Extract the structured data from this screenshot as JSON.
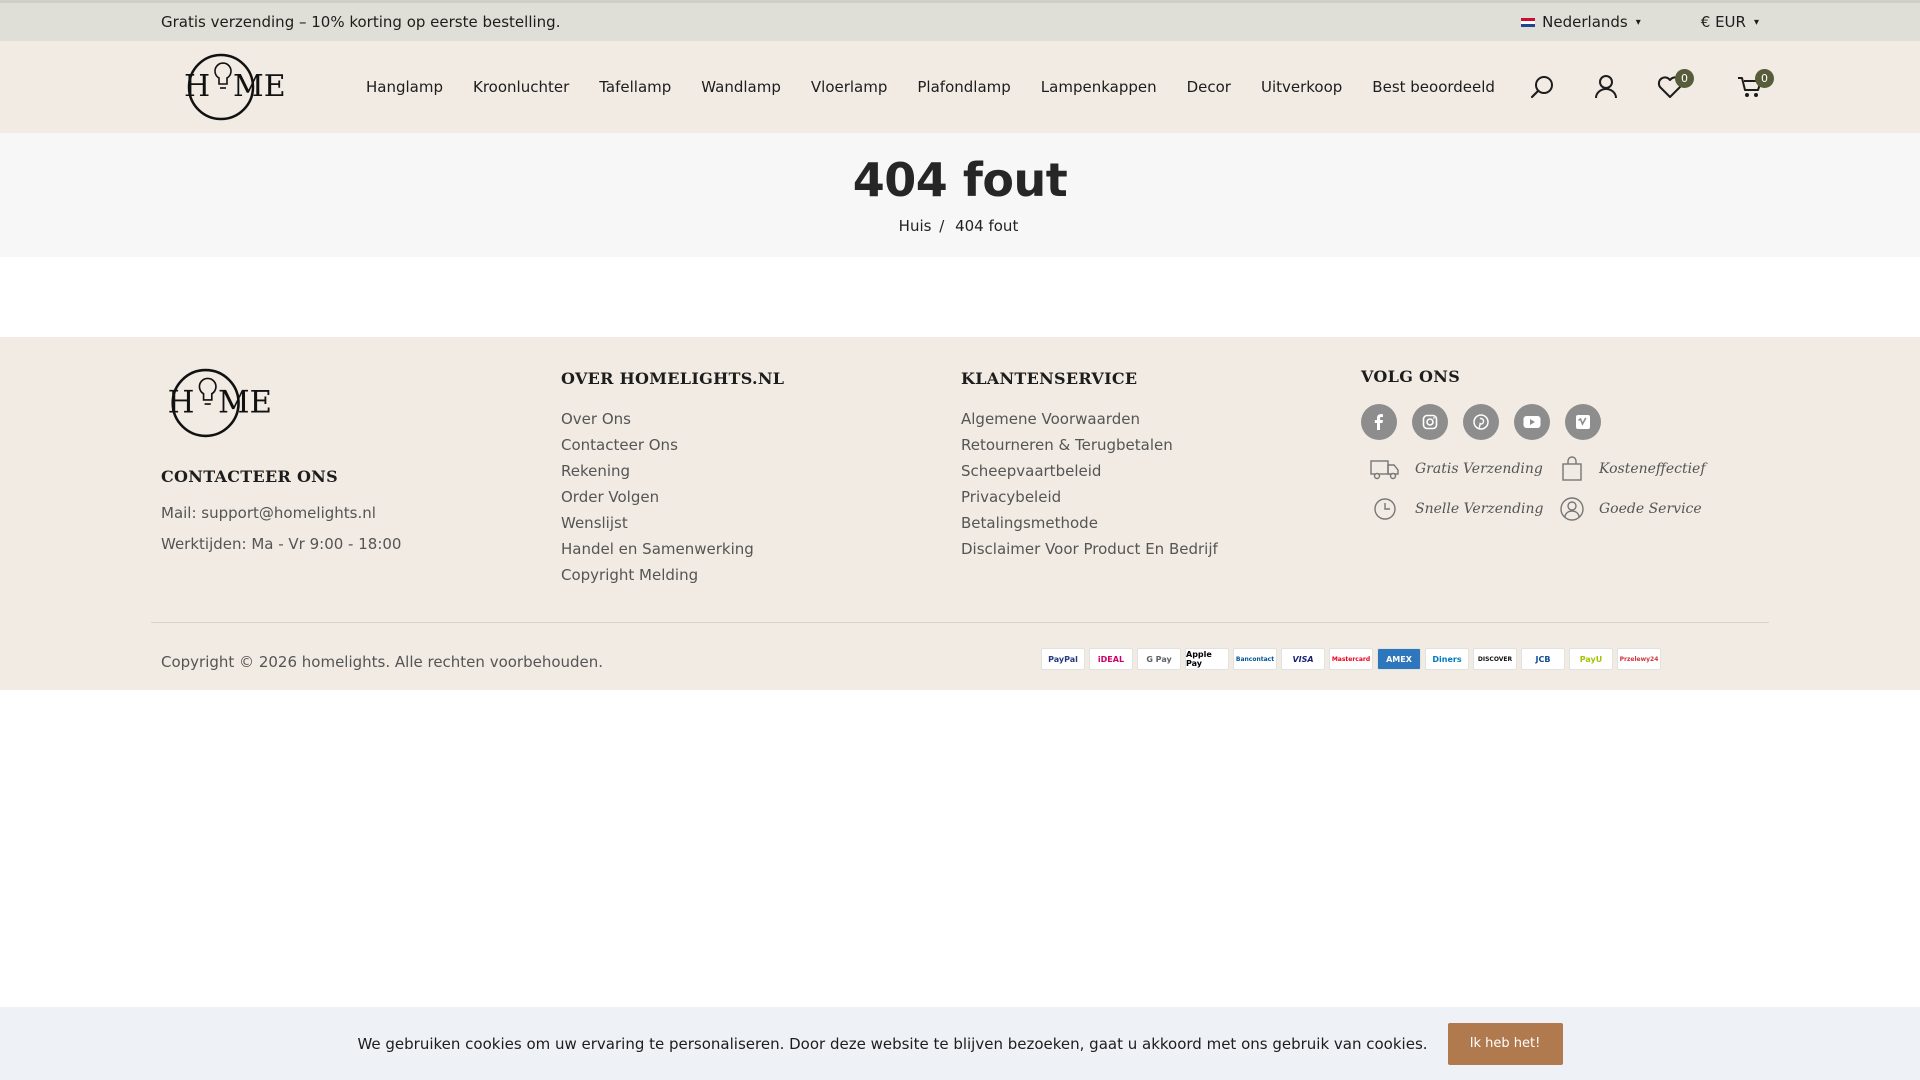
{
  "topbar": {
    "promo": "Gratis verzending – 10% korting op eerste bestelling.",
    "language": "Nederlands",
    "currency": "€ EUR"
  },
  "header": {
    "logo_text": "HOME",
    "nav": [
      "Hanglamp",
      "Kroonluchter",
      "Tafellamp",
      "Wandlamp",
      "Vloerlamp",
      "Plafondlamp",
      "Lampenkappen",
      "Decor",
      "Uitverkoop",
      "Best beoordeeld"
    ],
    "wishlist_count": "0",
    "cart_count": "0"
  },
  "page": {
    "title": "404 fout",
    "breadcrumb_home": "Huis",
    "breadcrumb_sep": "/",
    "breadcrumb_current": "404 fout"
  },
  "footer": {
    "contact": {
      "title": "CONTACTEER ONS",
      "mail": "Mail: support@homelights.nl",
      "hours": "Werktijden: Ma - Vr 9:00 - 18:00"
    },
    "about": {
      "title": "OVER HOMELIGHTS.NL",
      "links": [
        "Over Ons",
        "Contacteer Ons",
        "Rekening",
        "Order Volgen",
        "Wenslijst",
        "Handel en Samenwerking",
        "Copyright Melding"
      ]
    },
    "service": {
      "title": "KLANTENSERVICE",
      "links": [
        "Algemene Voorwaarden",
        "Retourneren & Terugbetalen",
        "Scheepvaartbeleid",
        "Privacybeleid",
        "Betalingsmethode",
        "Disclaimer Voor Product En Bedrijf"
      ]
    },
    "follow": {
      "title": "VOLG ONS",
      "features": [
        "Gratis Verzending",
        "Kosteneffectief",
        "Snelle Verzending",
        "Goede Service"
      ]
    },
    "copyright": "Copyright © 2026 homelights. Alle rechten voorbehouden.",
    "payments": [
      "PayPal",
      "iDEAL",
      "G Pay",
      "Apple Pay",
      "Bancontact",
      "VISA",
      "Mastercard",
      "AMEX",
      "Diners",
      "DISCOVER",
      "JCB",
      "PayU",
      "Przelewy24"
    ]
  },
  "cookie": {
    "text": "We gebruiken cookies om uw ervaring te personaliseren. Door deze website te blijven bezoeken, gaat u akkoord met ons gebruik van cookies.",
    "button": "Ik heb het!"
  }
}
